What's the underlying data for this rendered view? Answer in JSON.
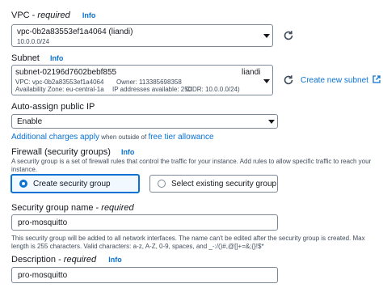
{
  "vpc": {
    "label": "VPC - ",
    "required": "required",
    "info": "Info",
    "value": "vpc-0b2a83553ef1a4064 (liandi)",
    "cidr": "10.0.0.0/24"
  },
  "subnet": {
    "label": "Subnet",
    "info": "Info",
    "value": "subnet-02196d7602bebf855",
    "name": "liandi",
    "vpc_line": "VPC: vpc-0b2a83553ef1a4064",
    "owner_line": "Owner: 113385698358",
    "az_line": "Availability Zone: eu-central-1a",
    "ip_line": "IP addresses available: 250",
    "cidr_line": "CIDR: 10.0.0.0/24)",
    "create_link": "Create new subnet"
  },
  "auto_assign": {
    "label": "Auto-assign public IP",
    "info": "Info",
    "value": "Enable",
    "charges_link": "Additional charges apply",
    "charges_mid": " when outside of ",
    "free_tier_link": "free tier allowance"
  },
  "firewall": {
    "label": "Firewall (security groups)",
    "info": "Info",
    "desc": "A security group is a set of firewall rules that control the traffic for your instance. Add rules to allow specific traffic to reach your instance.",
    "options": [
      {
        "label": "Create security group",
        "selected": true
      },
      {
        "label": "Select existing security group",
        "selected": false
      }
    ]
  },
  "sg_name": {
    "label": "Security group name - ",
    "required": "required",
    "value": "pro-mosquitto",
    "help": "This security group will be added to all network interfaces. The name can't be edited after the security group is created. Max length is 255 characters. Valid characters: a-z, A-Z, 0-9, spaces, and _-:/()#,@[]+=&;{}!$*"
  },
  "description": {
    "label": "Description - ",
    "required": "required",
    "info": "Info",
    "value": "pro-mosquitto"
  }
}
